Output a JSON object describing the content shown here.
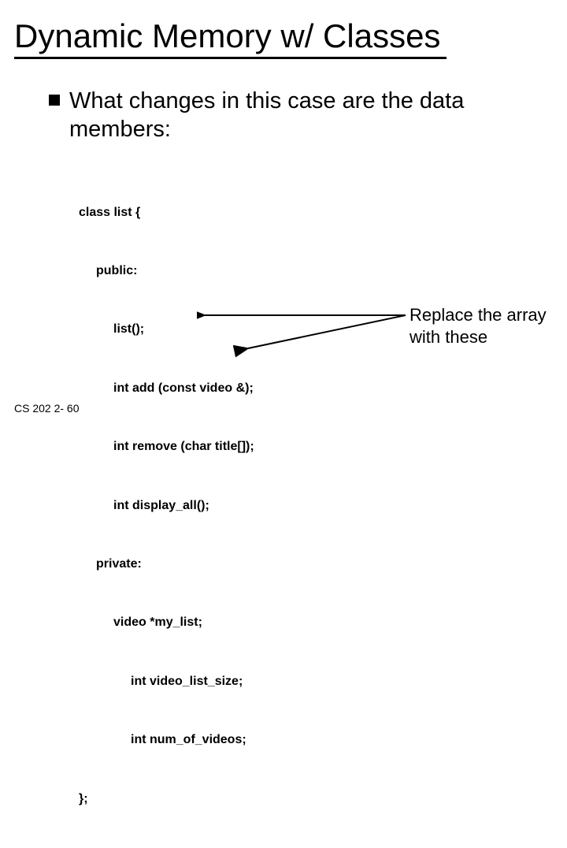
{
  "title": "Dynamic Memory w/ Classes",
  "bullet": "What changes in this case are the data members:",
  "code": {
    "l0": "class list {",
    "l1": "public:",
    "l2": "list();",
    "l3": "int add (const video &);",
    "l4": "int remove (char title[]);",
    "l5": "int display_all();",
    "l6": "private:",
    "l7": "video *my_list;",
    "l8": "int video_list_size;",
    "l9": "int num_of_videos;",
    "l10": "};"
  },
  "annotation_line1": "Replace the array",
  "annotation_line2": "with these",
  "footer": "CS 202   2- 60"
}
